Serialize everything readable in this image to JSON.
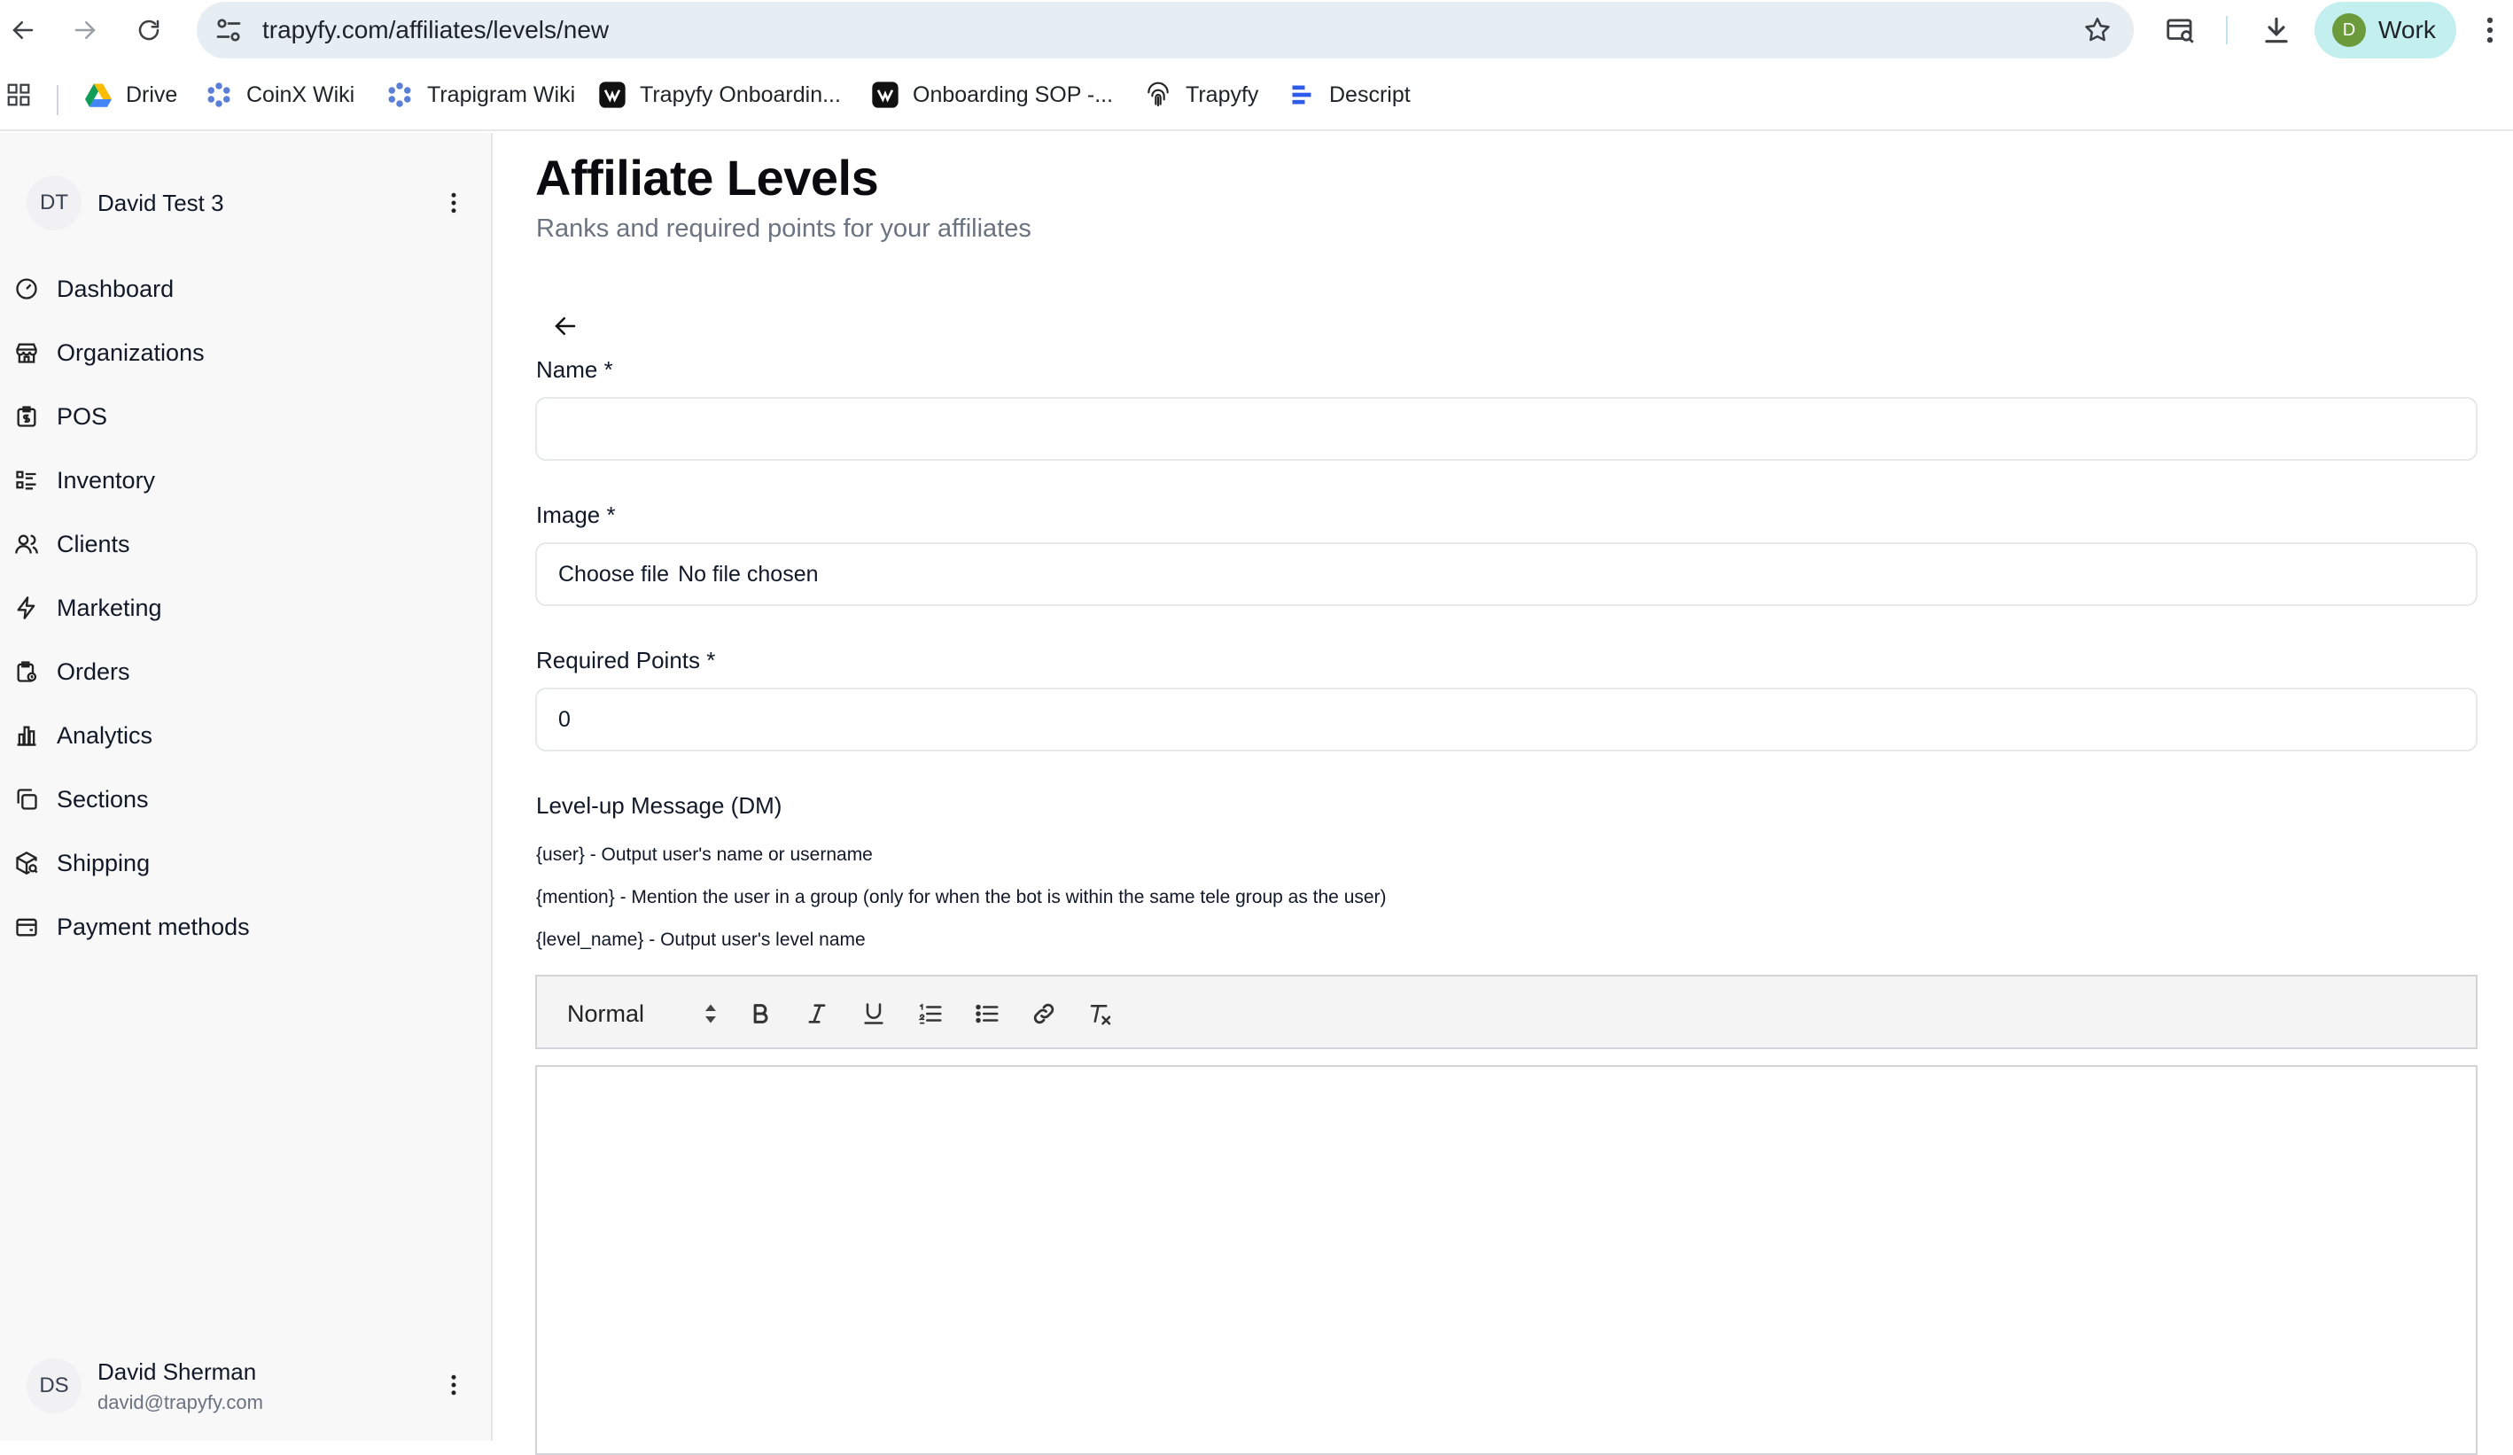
{
  "browser": {
    "url": "trapyfy.com/affiliates/levels/new",
    "profile_initial": "D",
    "profile_label": "Work"
  },
  "bookmarks": [
    {
      "label": "Drive",
      "icon": "drive-icon"
    },
    {
      "label": "CoinX Wiki",
      "icon": "wiki-icon"
    },
    {
      "label": "Trapigram Wiki",
      "icon": "wiki-icon"
    },
    {
      "label": "Trapyfy Onboardin...",
      "icon": "notion-icon"
    },
    {
      "label": "Onboarding SOP -...",
      "icon": "notion-icon"
    },
    {
      "label": "Trapyfy",
      "icon": "fingerprint-icon"
    },
    {
      "label": "Descript",
      "icon": "descript-icon"
    }
  ],
  "sidebar": {
    "org_initials": "DT",
    "org_name": "David Test 3",
    "items": [
      {
        "label": "Dashboard",
        "icon": "gauge-icon"
      },
      {
        "label": "Organizations",
        "icon": "store-icon"
      },
      {
        "label": "POS",
        "icon": "receipt-dollar-icon"
      },
      {
        "label": "Inventory",
        "icon": "list-checks-icon"
      },
      {
        "label": "Clients",
        "icon": "users-icon"
      },
      {
        "label": "Marketing",
        "icon": "zap-icon"
      },
      {
        "label": "Orders",
        "icon": "clipboard-icon"
      },
      {
        "label": "Analytics",
        "icon": "bar-chart-icon"
      },
      {
        "label": "Sections",
        "icon": "copy-icon"
      },
      {
        "label": "Shipping",
        "icon": "package-search-icon"
      },
      {
        "label": "Payment methods",
        "icon": "wallet-card-icon"
      }
    ],
    "user": {
      "initials": "DS",
      "name": "David Sherman",
      "email": "david@trapyfy.com"
    }
  },
  "page": {
    "title": "Affiliate Levels",
    "subtitle": "Ranks and required points for your affiliates"
  },
  "form": {
    "name_label": "Name *",
    "name_value": "",
    "image_label": "Image *",
    "file_button": "Choose file",
    "file_status": "No file chosen",
    "points_label": "Required Points *",
    "points_value": "0",
    "message_label": "Level-up Message (DM)",
    "hints": [
      "{user} - Output user's name or username",
      "{mention} - Mention the user in a group (only for when the bot is within the same tele group as the user)",
      "{level_name} - Output user's level name"
    ]
  },
  "editor": {
    "format_value": "Normal",
    "tools": [
      "bold-icon",
      "italic-icon",
      "underline-icon",
      "ordered-list-icon",
      "bullet-list-icon",
      "link-icon",
      "clear-format-icon"
    ],
    "content": ""
  }
}
